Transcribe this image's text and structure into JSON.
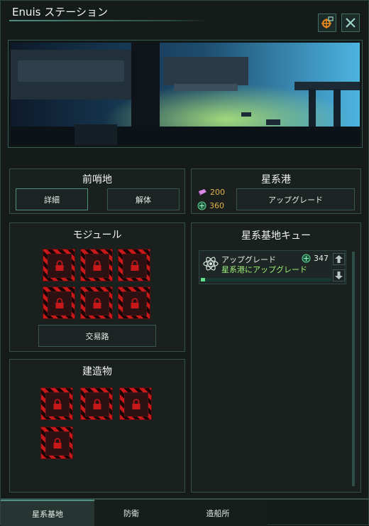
{
  "window": {
    "title": "Enuis ステーション"
  },
  "outpost": {
    "title": "前哨地",
    "details_label": "詳細",
    "dismantle_label": "解体"
  },
  "starport": {
    "title": "星系港",
    "alloys_cost": "200",
    "energy_cost": "360",
    "upgrade_label": "アップグレード"
  },
  "modules": {
    "title": "モジュール",
    "trade_route_label": "交易路"
  },
  "buildings": {
    "title": "建造物"
  },
  "queue": {
    "title": "星系基地キュー",
    "items": [
      {
        "name": "アップグレード",
        "detail": "星系港にアップグレード",
        "cost": "347",
        "progress": 0.02
      }
    ]
  },
  "tabs": [
    {
      "label": "星系基地",
      "active": true
    },
    {
      "label": "防衛",
      "active": false
    },
    {
      "label": "造船所",
      "active": false
    }
  ],
  "colors": {
    "accent": "#4f8f82",
    "lock_red": "#c8181a",
    "resource_text": "#e3b24a",
    "queue_text": "#9ff07a"
  },
  "icons": [
    "camera-target-icon",
    "close-icon",
    "lock-icon",
    "alloys-icon",
    "energy-icon",
    "atom-icon",
    "arrow-up-icon",
    "arrow-down-icon"
  ]
}
